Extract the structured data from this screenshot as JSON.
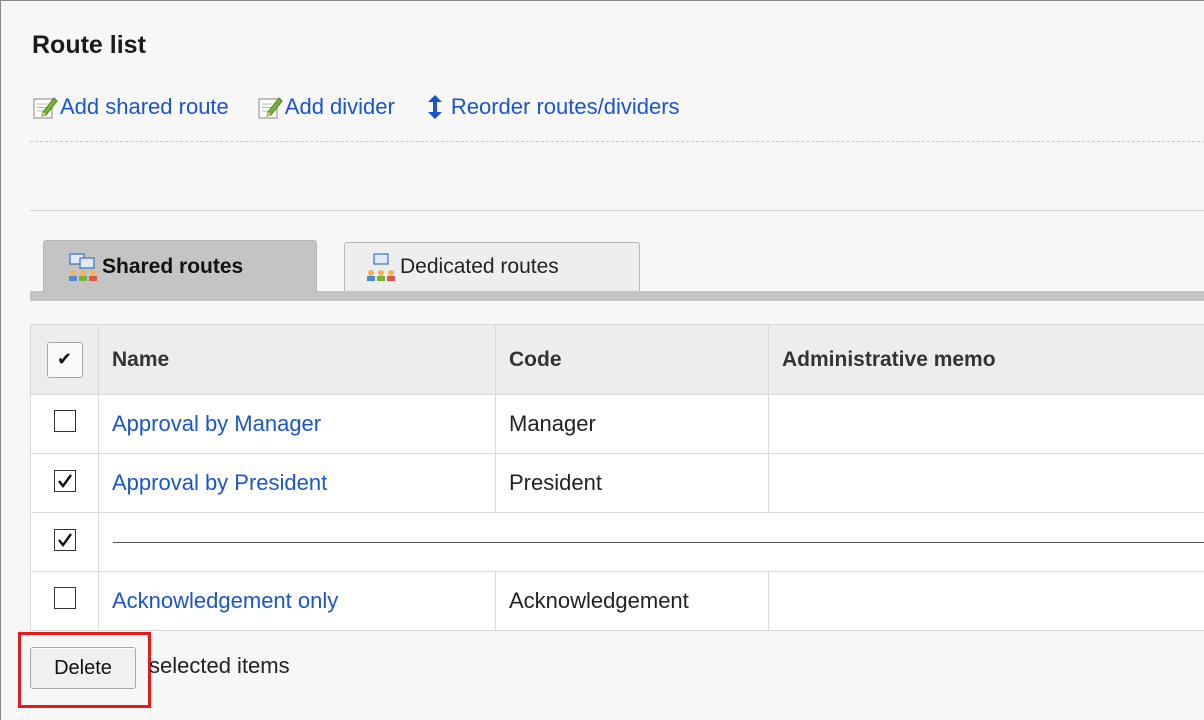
{
  "page": {
    "title": "Route list"
  },
  "toolbar": {
    "add_shared_route": "Add shared route",
    "add_divider": "Add divider",
    "reorder": "Reorder routes/dividers"
  },
  "tabs": [
    {
      "label": "Shared routes",
      "active": true
    },
    {
      "label": "Dedicated routes",
      "active": false
    }
  ],
  "table": {
    "check_all_glyph": "✔",
    "columns": [
      "Name",
      "Code",
      "Administrative memo"
    ],
    "rows": [
      {
        "type": "route",
        "checked": false,
        "name": "Approval by Manager",
        "code": "Manager",
        "memo": ""
      },
      {
        "type": "route",
        "checked": true,
        "name": "Approval by President",
        "code": "President",
        "memo": ""
      },
      {
        "type": "divider",
        "checked": true
      },
      {
        "type": "route",
        "checked": false,
        "name": "Acknowledgement only",
        "code": "Acknowledgement",
        "memo": ""
      }
    ]
  },
  "actions": {
    "delete_label": "Delete",
    "delete_suffix": "selected items",
    "highlight_color": "#e31b1b"
  },
  "colors": {
    "link": "#1a55cc",
    "tab_active_bg": "#c4c4c4",
    "header_bg": "#ededed"
  },
  "icons": {
    "add_shared_route": "edit-pencil-icon",
    "add_divider": "edit-pencil-icon",
    "reorder": "up-down-arrow-icon",
    "shared_tab": "shared-routes-icon",
    "dedicated_tab": "dedicated-routes-icon"
  }
}
